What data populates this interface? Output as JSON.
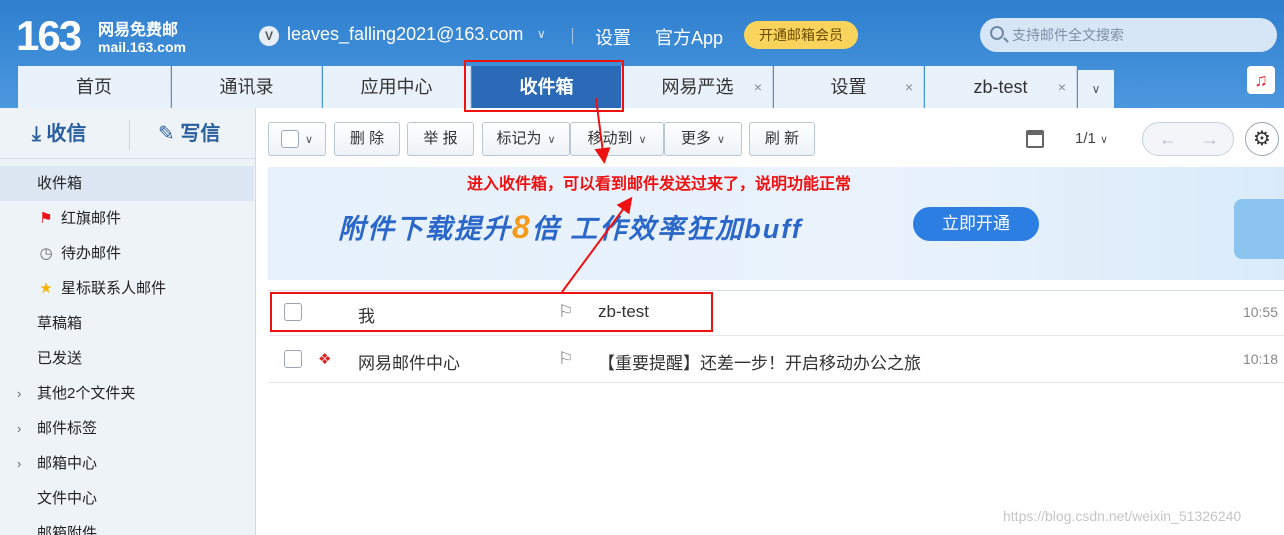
{
  "header": {
    "logo_number": "163",
    "logo_line1": "网易免费邮",
    "logo_line2": "mail.163.com",
    "account_badge": "V",
    "account_email": "leaves_falling2021@163.com",
    "links": [
      "设置",
      "官方App"
    ],
    "vip_button": "开通邮箱会员",
    "search_placeholder": "支持邮件全文搜索"
  },
  "tabs": [
    {
      "label": "首页",
      "active": false,
      "closable": false
    },
    {
      "label": "通讯录",
      "active": false,
      "closable": false
    },
    {
      "label": "应用中心",
      "active": false,
      "closable": false
    },
    {
      "label": "收件箱",
      "active": true,
      "closable": false
    },
    {
      "label": "网易严选",
      "active": false,
      "closable": true
    },
    {
      "label": "设置",
      "active": false,
      "closable": true
    },
    {
      "label": "zb-test",
      "active": false,
      "closable": true
    }
  ],
  "tab_close_glyph": "×",
  "sidebar": {
    "receive_label": "收信",
    "write_label": "写信",
    "items": [
      {
        "label": "收件箱",
        "icon": ""
      },
      {
        "label": "红旗邮件",
        "icon": "red-flag-icon"
      },
      {
        "label": "待办邮件",
        "icon": "clock-icon"
      },
      {
        "label": "星标联系人邮件",
        "icon": "star-icon"
      },
      {
        "label": "草稿箱",
        "icon": ""
      },
      {
        "label": "已发送",
        "icon": ""
      },
      {
        "label": "其他2个文件夹",
        "icon": "chevron-right-icon"
      },
      {
        "label": "邮件标签",
        "icon": "chevron-right-icon"
      },
      {
        "label": "邮箱中心",
        "icon": "chevron-right-icon"
      },
      {
        "label": "文件中心",
        "icon": ""
      },
      {
        "label": "邮箱附件",
        "icon": ""
      }
    ]
  },
  "toolbar": {
    "delete": "删 除",
    "report": "举 报",
    "mark_as": "标记为",
    "move_to": "移动到",
    "more": "更多",
    "refresh": "刷 新",
    "page_indicator": "1/1"
  },
  "banner": {
    "text_a": "附件下载提升",
    "text_num": "8",
    "text_b": "倍 工作效率狂加buff",
    "button": "立即开通"
  },
  "annotation": "进入收件箱，可以看到邮件发送过来了，说明功能正常",
  "mails": [
    {
      "from": "我",
      "subject": "zb-test",
      "time": "10:55",
      "has_logo": false
    },
    {
      "from": "网易邮件中心",
      "subject": "【重要提醒】还差一步！开启移动办公之旅",
      "time": "10:18",
      "has_logo": true
    }
  ],
  "watermark": "https://blog.csdn.net/weixin_51326240",
  "colors": {
    "header_blue": "#2f7fcf",
    "active_tab": "#2a6ab6",
    "vip_yellow": "#f8d45c",
    "annotation_red": "#ee1111"
  }
}
